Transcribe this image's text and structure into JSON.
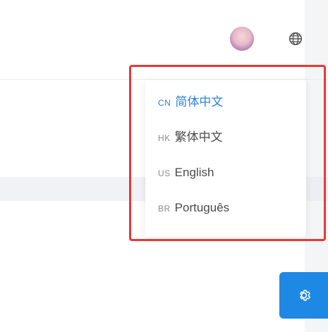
{
  "header": {
    "avatar_icon": "user-avatar",
    "language_icon": "globe-icon"
  },
  "language_menu": {
    "items": [
      {
        "code": "CN",
        "label": "简体中文",
        "active": true
      },
      {
        "code": "HK",
        "label": "繁体中文",
        "active": false
      },
      {
        "code": "US",
        "label": "English",
        "active": false
      },
      {
        "code": "BR",
        "label": "Português",
        "active": false
      }
    ]
  },
  "settings": {
    "icon": "gear-icon"
  },
  "colors": {
    "accent": "#1e88e5",
    "active_text": "#2c83e0",
    "highlight": "#e53935"
  }
}
